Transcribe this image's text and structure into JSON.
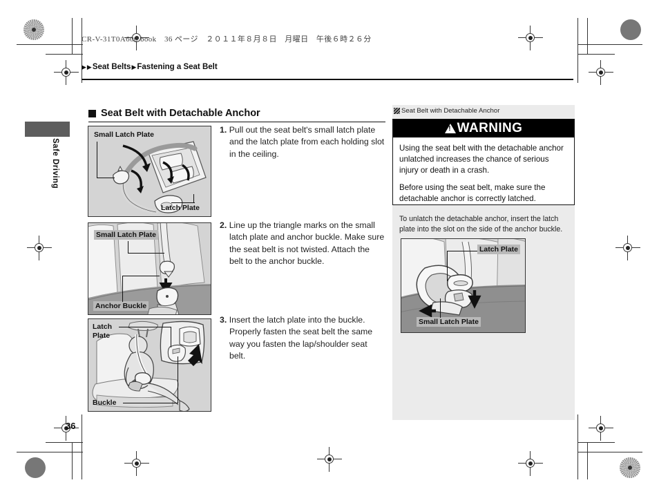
{
  "print": {
    "book_line": "CR-V-31T0A600.book　36 ページ　２０１１年８月８日　月曜日　午後６時２６分"
  },
  "breadcrumb": {
    "marker": "▶",
    "part1": "Seat Belts",
    "part2": "Fastening a Seat Belt"
  },
  "side_tab": {
    "label": "Safe Driving"
  },
  "section": {
    "title": "Seat Belt with Detachable Anchor"
  },
  "page": {
    "number": "36"
  },
  "steps": [
    {
      "number": "1.",
      "text": "Pull out the seat belt's small latch plate and the latch plate from each holding slot in the ceiling."
    },
    {
      "number": "2.",
      "text": "Line up the triangle marks on the small latch plate and anchor buckle. Make sure the seat belt is not twisted. Attach the belt to the anchor buckle."
    },
    {
      "number": "3.",
      "text": "Insert the latch plate into the buckle. Properly fasten the seat belt the same way you fasten the lap/shoulder seat belt."
    }
  ],
  "figures": [
    {
      "name": "figure-ceiling-holding-slot",
      "labels": [
        "Small Latch Plate",
        "Latch Plate"
      ]
    },
    {
      "name": "figure-anchor-buckle",
      "labels": [
        "Small Latch Plate",
        "Anchor Buckle"
      ]
    },
    {
      "name": "figure-occupant-buckle",
      "labels": [
        "Latch",
        "Plate",
        "Buckle"
      ]
    },
    {
      "name": "figure-unlatch-anchor",
      "labels": [
        "Latch Plate",
        "Small Latch Plate"
      ]
    }
  ],
  "right_column": {
    "reference": "Seat Belt with Detachable Anchor",
    "warning": {
      "heading": "WARNING",
      "paragraph1": "Using the seat belt with the detachable anchor unlatched increases the chance of serious injury or death in a crash.",
      "paragraph2": "Before using the seat belt, make sure the detachable anchor is correctly latched."
    },
    "unlatch_text": "To unlatch the detachable anchor, insert the latch plate into the slot on the side of the anchor buckle."
  },
  "colors": {
    "figure_background": "#d4d4d4",
    "panel_background": "#ebebeb",
    "tab": "#5d5d5d",
    "warning_bar": "#000000",
    "label_shade": "#b9b9b9"
  }
}
